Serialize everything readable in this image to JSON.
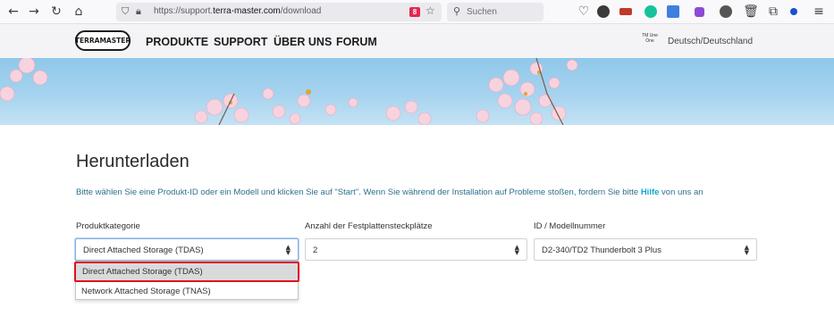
{
  "browser": {
    "url_prefix": "https://support.",
    "url_host": "terra-master.com",
    "url_path": "/download",
    "search_placeholder": "Suchen",
    "badge_text": "8"
  },
  "site": {
    "logo_text": "TERRAMASTER",
    "nav": [
      "PRODUKTE",
      "SUPPORT",
      "ÜBER UNS",
      "FORUM"
    ],
    "lang_icon_text": "TM Une One",
    "language": "Deutsch/Deutschland"
  },
  "page": {
    "title": "Herunterladen",
    "intro_before": "Bitte wählen Sie eine Produkt-ID oder ein Modell und klicken Sie auf \"Start\". Wenn Sie während der Installation auf Probleme stoßen, fordern Sie bitte ",
    "intro_link": "Hilfe",
    "intro_after": " von uns an"
  },
  "form": {
    "category_label": "Produktkategorie",
    "category_value": "Direct Attached Storage (TDAS)",
    "slots_label": "Anzahl der Festplattensteckplätze",
    "slots_value": "2",
    "model_label": "ID / Modellnummer",
    "model_value": "D2-340/TD2 Thunderbolt 3 Plus"
  },
  "dropdown": {
    "options": [
      "Direct Attached Storage (TDAS)",
      "Network Attached Storage (TNAS)"
    ],
    "highlight_color": "#e0101c"
  }
}
